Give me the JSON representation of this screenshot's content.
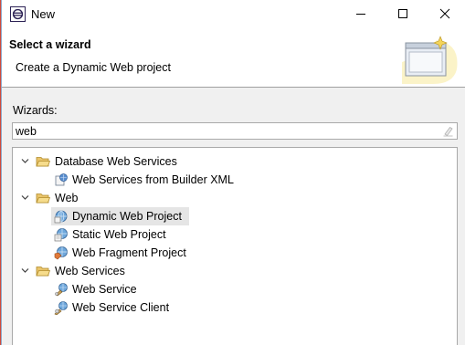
{
  "window": {
    "title": "New",
    "icon": "eclipse-icon"
  },
  "header": {
    "title": "Select a wizard",
    "description": "Create a Dynamic Web project"
  },
  "body": {
    "wizards_label": "Wizards:",
    "filter_value": "web"
  },
  "tree": {
    "groups": [
      {
        "label": "Database Web Services",
        "expanded": true,
        "items": [
          {
            "label": "Web Services from Builder XML",
            "icon": "web-services-xml-icon"
          }
        ]
      },
      {
        "label": "Web",
        "expanded": true,
        "items": [
          {
            "label": "Dynamic Web Project",
            "icon": "dynamic-web-project-icon",
            "selected": true
          },
          {
            "label": "Static Web Project",
            "icon": "static-web-project-icon"
          },
          {
            "label": "Web Fragment Project",
            "icon": "web-fragment-project-icon"
          }
        ]
      },
      {
        "label": "Web Services",
        "expanded": true,
        "items": [
          {
            "label": "Web Service",
            "icon": "web-service-icon"
          },
          {
            "label": "Web Service Client",
            "icon": "web-service-client-icon"
          }
        ]
      }
    ]
  },
  "colors": {
    "selection": "#e5e5e5",
    "folder": "#e8b84a",
    "dialog_background": "#f0f0f0"
  }
}
